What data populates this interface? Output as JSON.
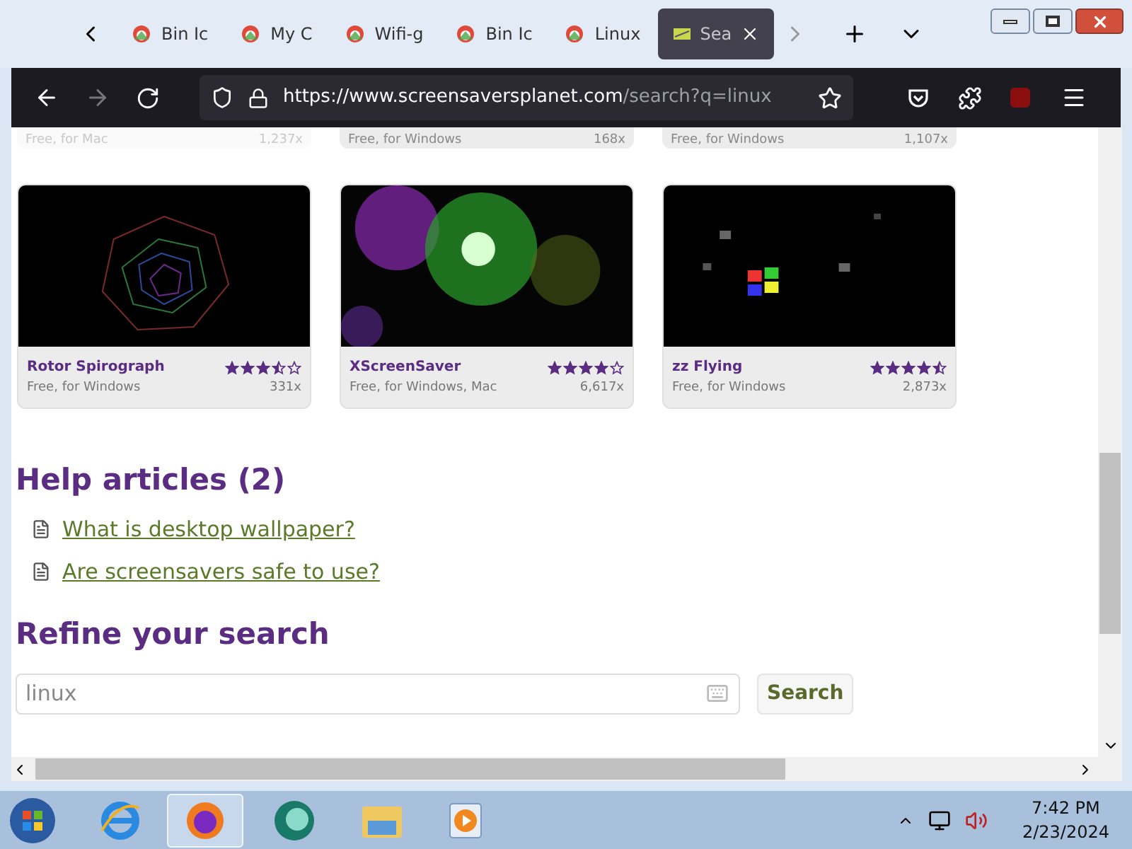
{
  "tabs": [
    {
      "label": "Bin Ic",
      "selected": false
    },
    {
      "label": "My C",
      "selected": false
    },
    {
      "label": "Wifi-g",
      "selected": false
    },
    {
      "label": "Bin Ic",
      "selected": false
    },
    {
      "label": "Linux",
      "selected": false
    },
    {
      "label": "Sea",
      "selected": true
    }
  ],
  "address_bar": {
    "url_host": "https://www.screensaversplanet.com",
    "url_path": "/search?q=linux"
  },
  "partial_cards": [
    {
      "platform": "Free, for Mac",
      "downloads": "1,237x"
    },
    {
      "platform": "Free, for Windows",
      "downloads": "168x"
    },
    {
      "platform": "Free, for Windows",
      "downloads": "1,107x"
    }
  ],
  "cards": [
    {
      "kind": "spiro",
      "title": "Rotor Spirograph",
      "stars": 3.5,
      "platform": "Free, for Windows",
      "downloads": "331x"
    },
    {
      "kind": "fireworks",
      "title": "XScreenSaver",
      "stars": 4,
      "platform": "Free, for Windows, Mac",
      "downloads": "6,617x"
    },
    {
      "kind": "flying",
      "title": "zz Flying",
      "stars": 4.5,
      "platform": "Free, for Windows",
      "downloads": "2,873x"
    }
  ],
  "help": {
    "heading": "Help articles (2)",
    "links": [
      "What is desktop wallpaper?",
      "Are screensavers safe to use?"
    ]
  },
  "refine": {
    "heading": "Refine your search",
    "value": "linux",
    "button": "Search"
  },
  "taskbar": {
    "time": "7:42 PM",
    "date": "2/23/2024"
  }
}
